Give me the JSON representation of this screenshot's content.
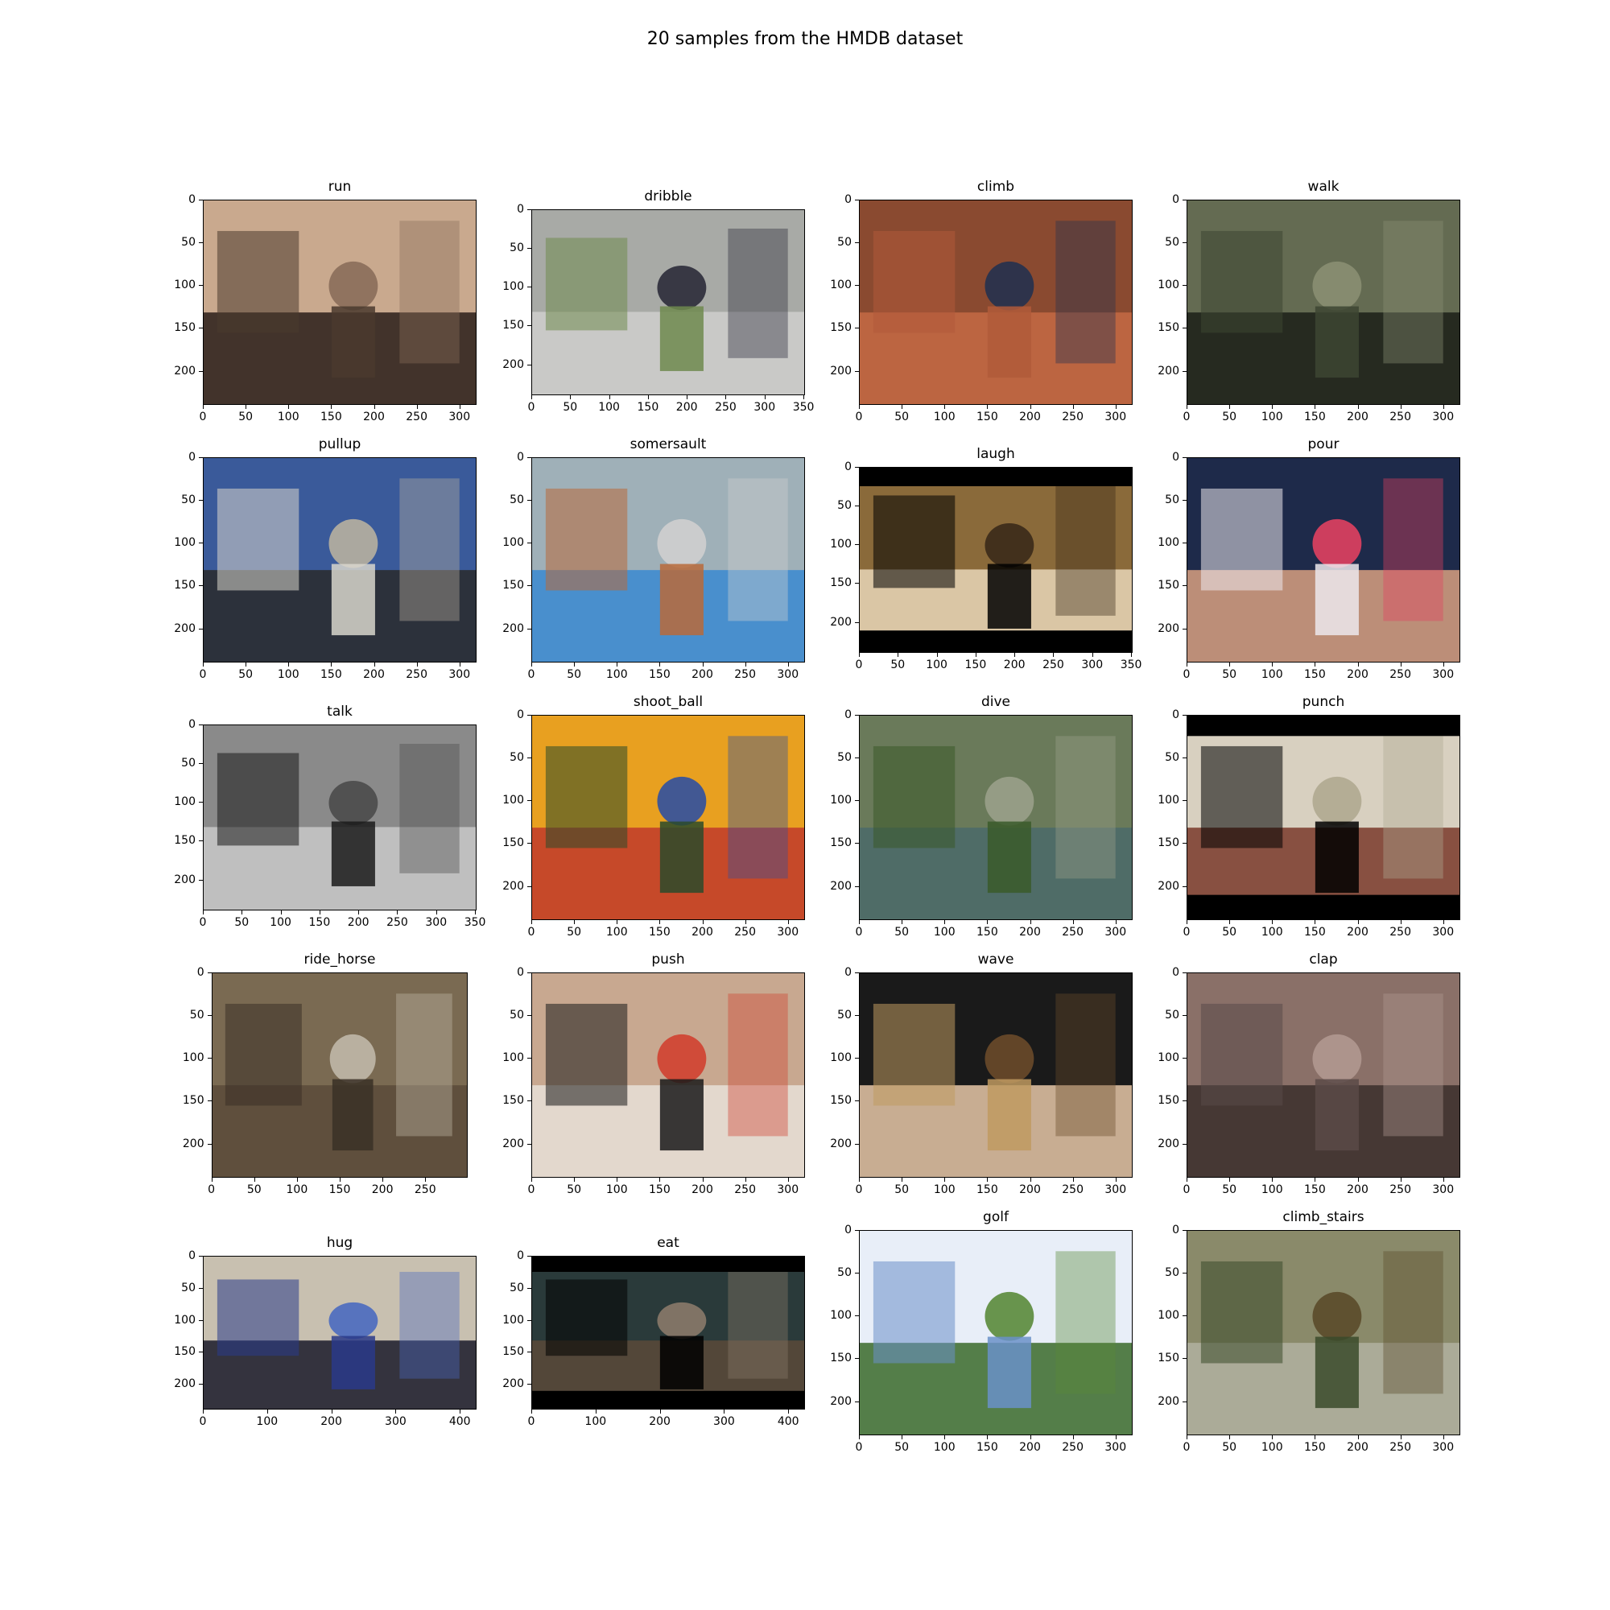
{
  "figure": {
    "title": "20 samples from the HMDB dataset"
  },
  "panels": [
    {
      "label": "run",
      "xticks": [
        "0",
        "50",
        "100",
        "150",
        "200",
        "250",
        "300"
      ],
      "yticks": [
        "0",
        "50",
        "100",
        "150",
        "200"
      ],
      "xmax": 320,
      "ymax": 240,
      "colors": [
        "#4a3a2e",
        "#c9a98e",
        "#2a1f1a",
        "#8a6d5a"
      ]
    },
    {
      "label": "dribble",
      "xticks": [
        "0",
        "50",
        "100",
        "150",
        "200",
        "250",
        "300",
        "350"
      ],
      "yticks": [
        "0",
        "50",
        "100",
        "150",
        "200"
      ],
      "xmax": 352,
      "ymax": 240,
      "colors": [
        "#6f8a4e",
        "#a8aaa6",
        "#cfcfcd",
        "#2b2b3a"
      ]
    },
    {
      "label": "climb",
      "xticks": [
        "0",
        "50",
        "100",
        "150",
        "200",
        "250",
        "300"
      ],
      "yticks": [
        "0",
        "50",
        "100",
        "150",
        "200"
      ],
      "xmax": 320,
      "ymax": 240,
      "colors": [
        "#b05a3a",
        "#8a4a30",
        "#c46a44",
        "#23314f"
      ]
    },
    {
      "label": "walk",
      "xticks": [
        "0",
        "50",
        "100",
        "150",
        "200",
        "250",
        "300"
      ],
      "yticks": [
        "0",
        "50",
        "100",
        "150",
        "200"
      ],
      "xmax": 320,
      "ymax": 240,
      "colors": [
        "#3d4532",
        "#646b52",
        "#1b1f17",
        "#8a8f72"
      ]
    },
    {
      "label": "pullup",
      "xticks": [
        "0",
        "50",
        "100",
        "150",
        "200",
        "250",
        "300"
      ],
      "yticks": [
        "0",
        "50",
        "100",
        "150",
        "200"
      ],
      "xmax": 320,
      "ymax": 240,
      "colors": [
        "#d8d6cc",
        "#3a5a9a",
        "#2a2a2a",
        "#b8b0a0"
      ]
    },
    {
      "label": "somersault",
      "xticks": [
        "0",
        "50",
        "100",
        "150",
        "200",
        "250",
        "300"
      ],
      "yticks": [
        "0",
        "50",
        "100",
        "150",
        "200"
      ],
      "xmax": 320,
      "ymax": 240,
      "colors": [
        "#b86a3a",
        "#9fb0b8",
        "#3a8ad0",
        "#cfcfcf"
      ]
    },
    {
      "label": "laugh",
      "xticks": [
        "0",
        "50",
        "100",
        "150",
        "200",
        "250",
        "300",
        "350"
      ],
      "yticks": [
        "0",
        "50",
        "100",
        "150",
        "200"
      ],
      "xmax": 352,
      "ymax": 240,
      "colors": [
        "#000000",
        "#8a6a3a",
        "#e8d6b8",
        "#3a2a1a"
      ]
    },
    {
      "label": "pour",
      "xticks": [
        "0",
        "50",
        "100",
        "150",
        "200",
        "250",
        "300"
      ],
      "yticks": [
        "0",
        "50",
        "100",
        "150",
        "200"
      ],
      "xmax": 320,
      "ymax": 240,
      "colors": [
        "#ece8ec",
        "#1e2a4a",
        "#d8a080",
        "#e04060"
      ]
    },
    {
      "label": "talk",
      "xticks": [
        "0",
        "50",
        "100",
        "150",
        "200",
        "250",
        "300",
        "350"
      ],
      "yticks": [
        "0",
        "50",
        "100",
        "150",
        "200"
      ],
      "xmax": 352,
      "ymax": 240,
      "colors": [
        "#1a1a1a",
        "#8a8a8a",
        "#c8c8c8",
        "#4a4a4a"
      ]
    },
    {
      "label": "shoot_ball",
      "xticks": [
        "0",
        "50",
        "100",
        "150",
        "200",
        "250",
        "300"
      ],
      "yticks": [
        "0",
        "50",
        "100",
        "150",
        "200"
      ],
      "xmax": 320,
      "ymax": 240,
      "colors": [
        "#2a4a2a",
        "#e8a020",
        "#c0392b",
        "#3050a0"
      ]
    },
    {
      "label": "dive",
      "xticks": [
        "0",
        "50",
        "100",
        "150",
        "200",
        "250",
        "300"
      ],
      "yticks": [
        "0",
        "50",
        "100",
        "150",
        "200"
      ],
      "xmax": 320,
      "ymax": 240,
      "colors": [
        "#3a5a2a",
        "#6a7a5a",
        "#4a6a6a",
        "#9aa08a"
      ]
    },
    {
      "label": "punch",
      "xticks": [
        "0",
        "50",
        "100",
        "150",
        "200",
        "250",
        "300"
      ],
      "yticks": [
        "0",
        "50",
        "100",
        "150",
        "200"
      ],
      "xmax": 320,
      "ymax": 240,
      "colors": [
        "#000000",
        "#d8d0c0",
        "#7a3a2a",
        "#b0a890"
      ]
    },
    {
      "label": "ride_horse",
      "xticks": [
        "0",
        "50",
        "100",
        "150",
        "200",
        "250"
      ],
      "yticks": [
        "0",
        "50",
        "100",
        "150",
        "200"
      ],
      "xmax": 300,
      "ymax": 240,
      "colors": [
        "#3a3026",
        "#7a6a52",
        "#5a4a3a",
        "#c0b8a8"
      ]
    },
    {
      "label": "push",
      "xticks": [
        "0",
        "50",
        "100",
        "150",
        "200",
        "250",
        "300"
      ],
      "yticks": [
        "0",
        "50",
        "100",
        "150",
        "200"
      ],
      "xmax": 320,
      "ymax": 240,
      "colors": [
        "#1a1a1a",
        "#c8a890",
        "#e8e0d8",
        "#d04030"
      ]
    },
    {
      "label": "wave",
      "xticks": [
        "0",
        "50",
        "100",
        "150",
        "200",
        "250",
        "300"
      ],
      "yticks": [
        "0",
        "50",
        "100",
        "150",
        "200"
      ],
      "xmax": 320,
      "ymax": 240,
      "colors": [
        "#c09a60",
        "#1a1a1a",
        "#e8c8a8",
        "#6a4a2a"
      ]
    },
    {
      "label": "clap",
      "xticks": [
        "0",
        "50",
        "100",
        "150",
        "200",
        "250",
        "300"
      ],
      "yticks": [
        "0",
        "50",
        "100",
        "150",
        "200"
      ],
      "xmax": 320,
      "ymax": 240,
      "colors": [
        "#5a4a48",
        "#8a7068",
        "#3a2e2c",
        "#b09890"
      ]
    },
    {
      "label": "hug",
      "xticks": [
        "0",
        "100",
        "200",
        "300",
        "400"
      ],
      "yticks": [
        "0",
        "50",
        "100",
        "150",
        "200"
      ],
      "xmax": 426,
      "ymax": 240,
      "colors": [
        "#2a3a8a",
        "#c8c0b0",
        "#1a1a2a",
        "#4a6ac0"
      ]
    },
    {
      "label": "eat",
      "xticks": [
        "0",
        "100",
        "200",
        "300",
        "400"
      ],
      "yticks": [
        "0",
        "50",
        "100",
        "150",
        "200"
      ],
      "xmax": 426,
      "ymax": 240,
      "colors": [
        "#000000",
        "#2a3a3a",
        "#5a4a3a",
        "#8a7a6a"
      ]
    },
    {
      "label": "golf",
      "xticks": [
        "0",
        "50",
        "100",
        "150",
        "200",
        "250",
        "300"
      ],
      "yticks": [
        "0",
        "50",
        "100",
        "150",
        "200"
      ],
      "xmax": 320,
      "ymax": 240,
      "colors": [
        "#6a90c8",
        "#e8eef8",
        "#3a6a2a",
        "#5a8a3a"
      ]
    },
    {
      "label": "climb_stairs",
      "xticks": [
        "0",
        "50",
        "100",
        "150",
        "200",
        "250",
        "300"
      ],
      "yticks": [
        "0",
        "50",
        "100",
        "150",
        "200"
      ],
      "xmax": 320,
      "ymax": 240,
      "colors": [
        "#3a4a2a",
        "#8a8a6a",
        "#b0b0a0",
        "#5a4a2a"
      ]
    }
  ]
}
